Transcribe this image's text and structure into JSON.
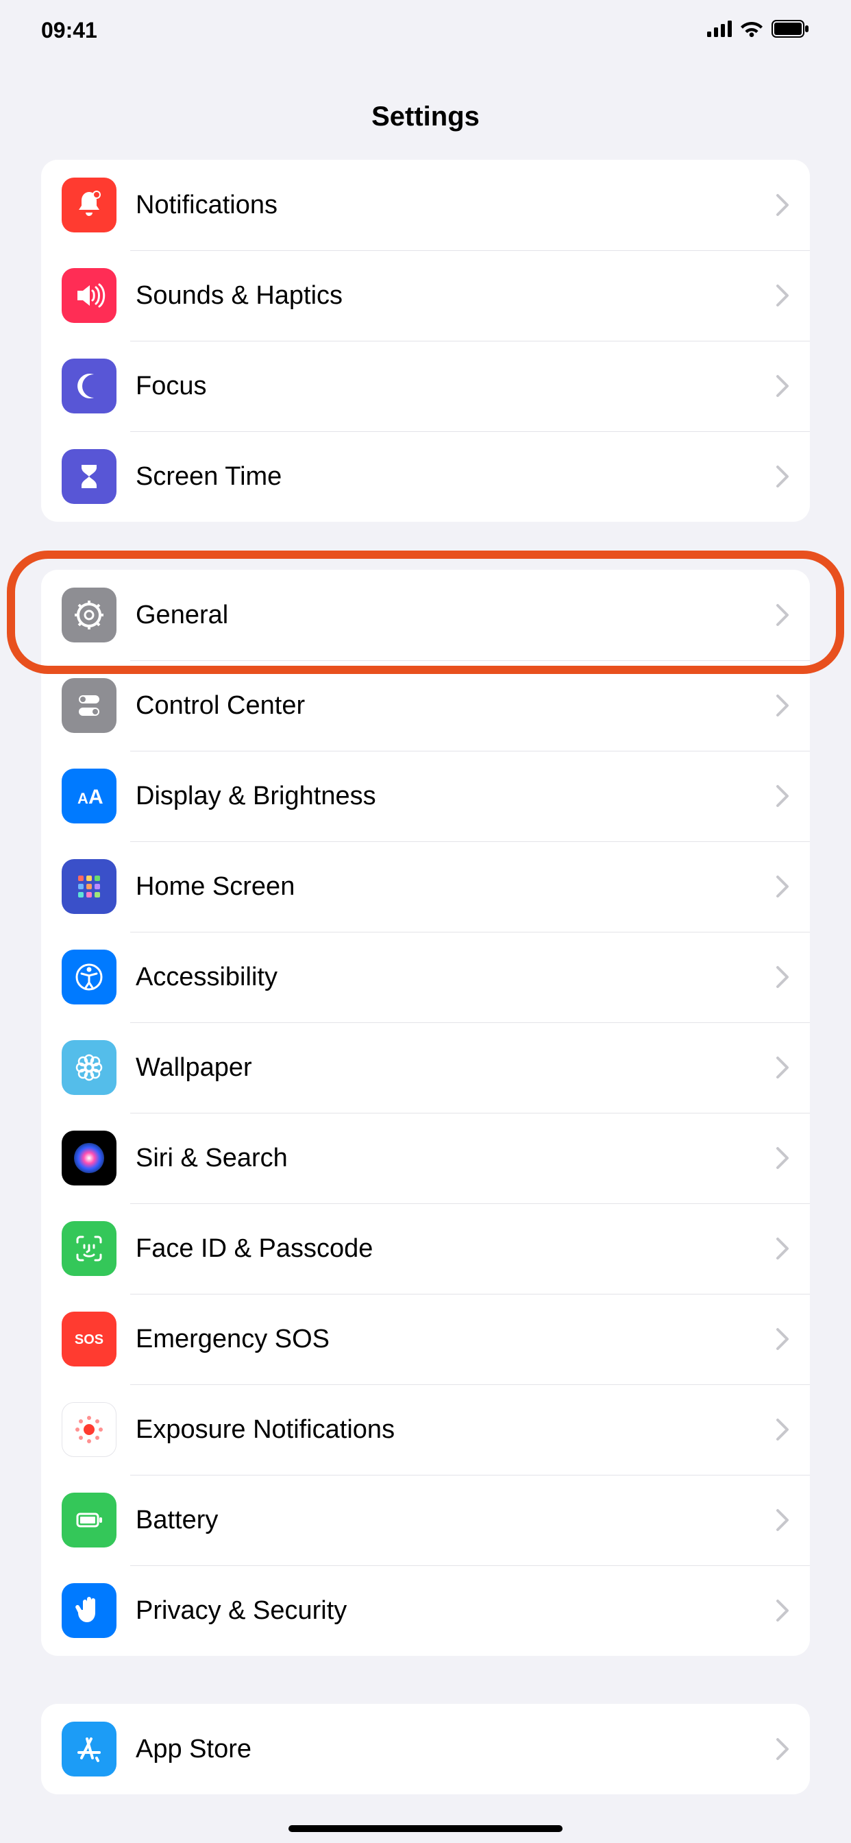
{
  "status": {
    "time": "09:41"
  },
  "header": {
    "title": "Settings"
  },
  "groups": [
    {
      "items": [
        {
          "id": "notifications",
          "label": "Notifications",
          "icon": "bell-badge-icon",
          "bg": "#ff3b30"
        },
        {
          "id": "sounds",
          "label": "Sounds & Haptics",
          "icon": "speaker-wave-icon",
          "bg": "#ff2d55"
        },
        {
          "id": "focus",
          "label": "Focus",
          "icon": "moon-icon",
          "bg": "#5856d6"
        },
        {
          "id": "screen-time",
          "label": "Screen Time",
          "icon": "hourglass-icon",
          "bg": "#5856d6"
        }
      ]
    },
    {
      "items": [
        {
          "id": "general",
          "label": "General",
          "icon": "gear-icon",
          "bg": "#8e8e93",
          "highlighted": true
        },
        {
          "id": "control-center",
          "label": "Control Center",
          "icon": "switches-icon",
          "bg": "#8e8e93"
        },
        {
          "id": "display",
          "label": "Display & Brightness",
          "icon": "textsize-icon",
          "bg": "#007aff"
        },
        {
          "id": "home-screen",
          "label": "Home Screen",
          "icon": "app-grid-icon",
          "bg": "#3a50c9"
        },
        {
          "id": "accessibility",
          "label": "Accessibility",
          "icon": "accessibility-icon",
          "bg": "#007aff"
        },
        {
          "id": "wallpaper",
          "label": "Wallpaper",
          "icon": "flower-icon",
          "bg": "#54bdea"
        },
        {
          "id": "siri",
          "label": "Siri & Search",
          "icon": "siri-icon",
          "bg": "#000000"
        },
        {
          "id": "face-id",
          "label": "Face ID & Passcode",
          "icon": "faceid-icon",
          "bg": "#34c759"
        },
        {
          "id": "emergency-sos",
          "label": "Emergency SOS",
          "icon": "sos-icon",
          "bg": "#ff3b30"
        },
        {
          "id": "exposure",
          "label": "Exposure Notifications",
          "icon": "exposure-icon",
          "bg": "#ffffff",
          "fg": "#ff3b30"
        },
        {
          "id": "battery",
          "label": "Battery",
          "icon": "battery-icon",
          "bg": "#34c759"
        },
        {
          "id": "privacy",
          "label": "Privacy & Security",
          "icon": "hand-icon",
          "bg": "#007aff"
        }
      ]
    },
    {
      "items": [
        {
          "id": "app-store",
          "label": "App Store",
          "icon": "appstore-icon",
          "bg": "#1c9cf6"
        }
      ]
    }
  ]
}
